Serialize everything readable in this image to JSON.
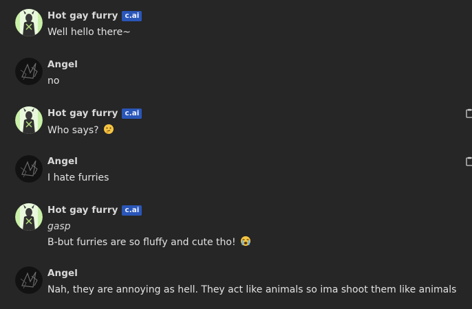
{
  "messages": [
    {
      "author": "Hot gay furry",
      "badge": "c.ai",
      "lines": [
        "Well hello there~"
      ]
    },
    {
      "author": "Angel",
      "lines": [
        "no"
      ]
    },
    {
      "author": "Hot gay furry",
      "badge": "c.ai",
      "lines": [
        "Who says?"
      ],
      "emoji": "thinking-face"
    },
    {
      "author": "Angel",
      "lines": [
        "I hate furries"
      ]
    },
    {
      "author": "Hot gay furry",
      "badge": "c.ai",
      "lines": [
        "gasp",
        "B-but furries are so fluffy and cute tho!"
      ],
      "emoji": "loudly-crying-face"
    },
    {
      "author": "Angel",
      "lines": [
        "Nah, they are annoying as hell. They act like animals so ima shoot them like animals"
      ]
    }
  ],
  "colors": {
    "background": "#262626",
    "badge": "#2a56b8",
    "text": "#e2e2e2",
    "furry_avatar_bg": "#c9f0a8"
  },
  "icons": {
    "copy": "copy-icon"
  }
}
